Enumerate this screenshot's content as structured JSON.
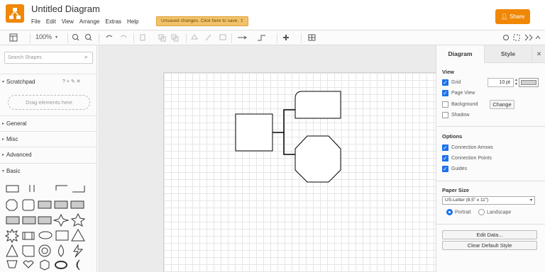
{
  "app": {
    "title": "Untitled Diagram",
    "menu": [
      "File",
      "Edit",
      "View",
      "Arrange",
      "Extras",
      "Help"
    ],
    "unsaved_notice": "Unsaved changes. Click here to save.",
    "share_label": "Share",
    "brand_color": "#f08705"
  },
  "toolbar": {
    "zoom": "100%",
    "icons": [
      "sidebar-toggle-icon",
      "zoom-in-icon",
      "zoom-out-icon",
      "undo-icon",
      "redo-icon",
      "delete-icon",
      "to-front-icon",
      "to-back-icon",
      "fill-color-icon",
      "line-color-icon",
      "shadow-icon",
      "connection-icon",
      "waypoints-icon",
      "insert-icon",
      "table-icon",
      "format-icon",
      "fullscreen-icon",
      "collapse-icon"
    ]
  },
  "sidebar": {
    "search_placeholder": "Search Shapes",
    "scratchpad": "Scratchpad",
    "dropzone": "Drag elements here",
    "sections": [
      "General",
      "Misc",
      "Advanced",
      "Basic"
    ]
  },
  "format_panel": {
    "tabs": [
      "Diagram",
      "Style"
    ],
    "view_title": "View",
    "grid_label": "Grid",
    "grid_size": "10 pt",
    "page_view_label": "Page View",
    "background_label": "Background",
    "change_label": "Change",
    "shadow_label": "Shadow",
    "options_title": "Options",
    "connection_arrows": "Connection Arrows",
    "connection_points": "Connection Points",
    "guides": "Guides",
    "paper_size_title": "Paper Size",
    "paper_size_value": "US-Letter (8,5\" x 11\")",
    "portrait": "Portrait",
    "landscape": "Landscape",
    "edit_data": "Edit Data...",
    "clear_default_style": "Clear Default Style"
  }
}
